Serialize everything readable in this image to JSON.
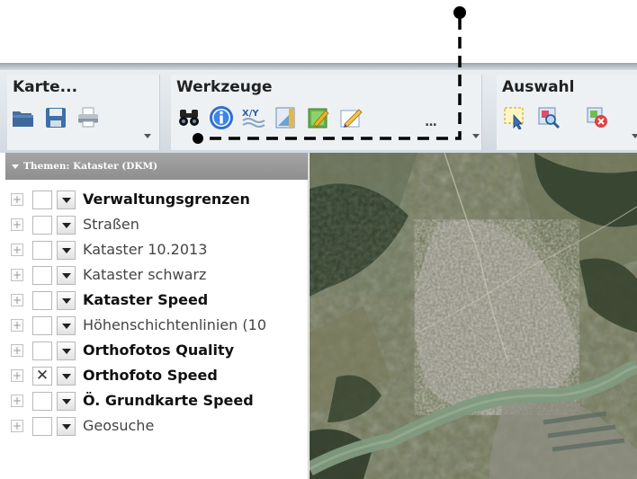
{
  "toolbar": {
    "groups": [
      {
        "title": "Karte...",
        "tools": [
          "folder-icon",
          "save-icon",
          "print-icon"
        ]
      },
      {
        "title": "Werkzeuge",
        "tools": [
          "binoculars-icon",
          "info-icon",
          "coordinates-icon",
          "measure-icon",
          "edit-icon",
          "draw-icon"
        ],
        "more": "..."
      },
      {
        "title": "Auswahl",
        "tools": [
          "select-icon",
          "select-zoom-icon",
          "clear-selection-icon"
        ]
      }
    ]
  },
  "panel": {
    "title": "Themen: Kataster (DKM)",
    "layers": [
      {
        "label": "Verwaltungsgrenzen",
        "bold": true,
        "checked": false
      },
      {
        "label": "Straßen",
        "bold": false,
        "checked": false
      },
      {
        "label": "Kataster 10.2013",
        "bold": false,
        "checked": false
      },
      {
        "label": "Kataster schwarz",
        "bold": false,
        "checked": false
      },
      {
        "label": "Kataster Speed",
        "bold": true,
        "checked": false
      },
      {
        "label": "Höhenschichtenlinien (10",
        "bold": false,
        "checked": false
      },
      {
        "label": "Orthofotos Quality",
        "bold": true,
        "checked": false
      },
      {
        "label": "Orthofoto Speed",
        "bold": true,
        "checked": true
      },
      {
        "label": "Ö. Grundkarte Speed",
        "bold": true,
        "checked": false
      },
      {
        "label": "Geosuche",
        "bold": false,
        "checked": false
      }
    ],
    "expander_symbol": "+",
    "check_symbol": "✕"
  },
  "colors": {
    "panel_header": "#999999",
    "callout_line": "#000000",
    "river": "#7f9a80"
  }
}
